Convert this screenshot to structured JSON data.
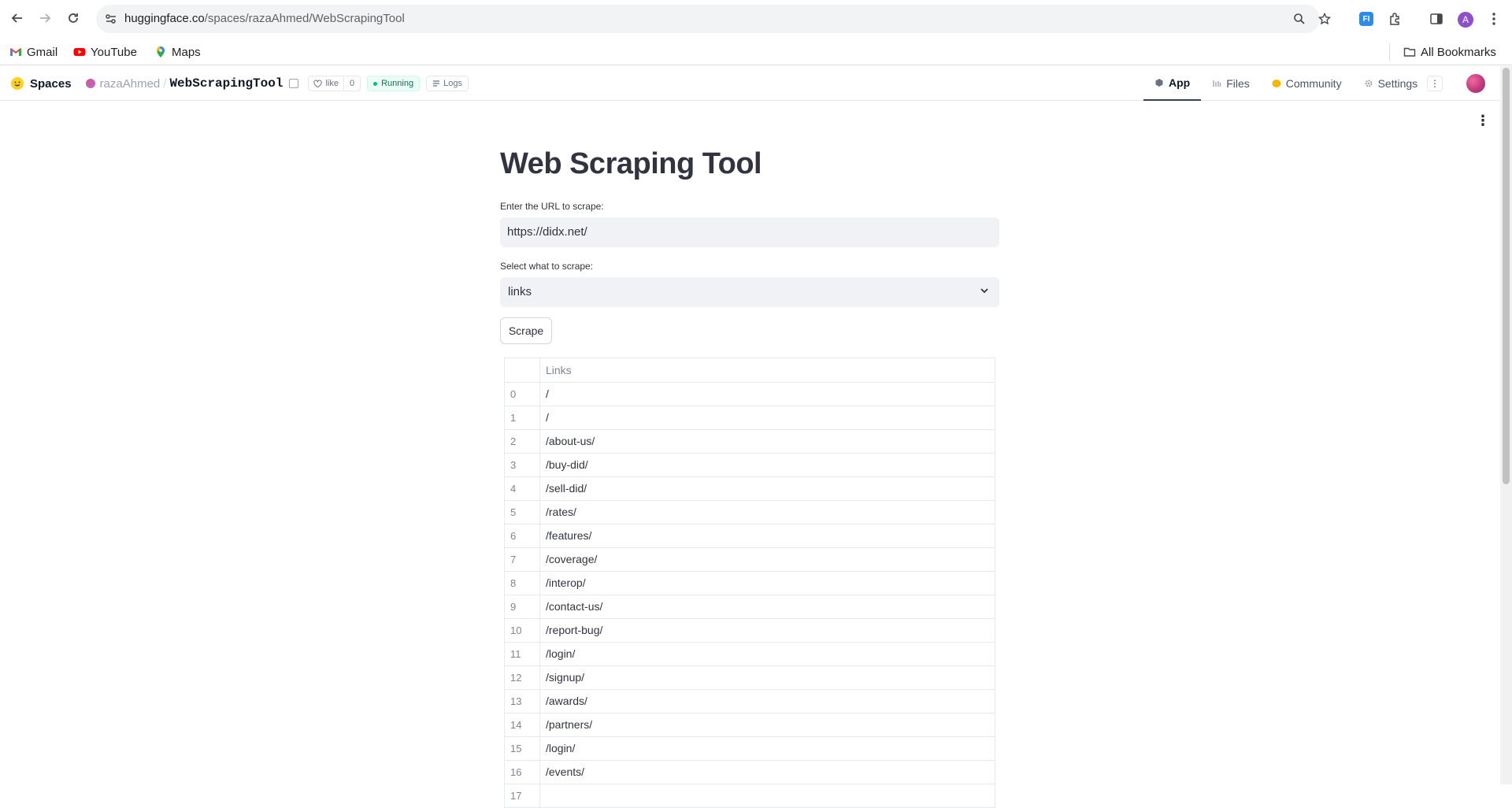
{
  "browser": {
    "url_host": "huggingface.co",
    "url_path": "/spaces/razaAhmed/WebScrapingTool",
    "profile_initial": "A",
    "bookmarks": [
      {
        "label": "Gmail",
        "icon": "gmail-icon"
      },
      {
        "label": "YouTube",
        "icon": "youtube-icon"
      },
      {
        "label": "Maps",
        "icon": "maps-icon"
      }
    ],
    "all_bookmarks": "All Bookmarks"
  },
  "hf": {
    "spaces_label": "Spaces",
    "owner": "razaAhmed",
    "repo": "WebScrapingTool",
    "like_label": "like",
    "like_count": "0",
    "status": "Running",
    "logs_label": "Logs",
    "tabs": [
      {
        "label": "App",
        "icon": "app-icon",
        "active": true
      },
      {
        "label": "Files",
        "icon": "files-icon",
        "active": false
      },
      {
        "label": "Community",
        "icon": "community-icon",
        "active": false
      },
      {
        "label": "Settings",
        "icon": "settings-icon",
        "active": false
      }
    ]
  },
  "app": {
    "title": "Web Scraping Tool",
    "url_label": "Enter the URL to scrape:",
    "url_value": "https://didx.net/",
    "select_label": "Select what to scrape:",
    "select_value": "links",
    "scrape_button": "Scrape",
    "table": {
      "column": "Links",
      "rows": [
        {
          "index": "0",
          "value": "/"
        },
        {
          "index": "1",
          "value": "/"
        },
        {
          "index": "2",
          "value": "/about-us/"
        },
        {
          "index": "3",
          "value": "/buy-did/"
        },
        {
          "index": "4",
          "value": "/sell-did/"
        },
        {
          "index": "5",
          "value": "/rates/"
        },
        {
          "index": "6",
          "value": "/features/"
        },
        {
          "index": "7",
          "value": "/coverage/"
        },
        {
          "index": "8",
          "value": "/interop/"
        },
        {
          "index": "9",
          "value": "/contact-us/"
        },
        {
          "index": "10",
          "value": "/report-bug/"
        },
        {
          "index": "11",
          "value": "/login/"
        },
        {
          "index": "12",
          "value": "/signup/"
        },
        {
          "index": "13",
          "value": "/awards/"
        },
        {
          "index": "14",
          "value": "/partners/"
        },
        {
          "index": "15",
          "value": "/login/"
        },
        {
          "index": "16",
          "value": "/events/"
        },
        {
          "index": "17",
          "value": ""
        }
      ]
    }
  },
  "colors": {
    "accent_running": "#10b981",
    "input_bg": "#f0f2f6",
    "text": "#31333f"
  }
}
